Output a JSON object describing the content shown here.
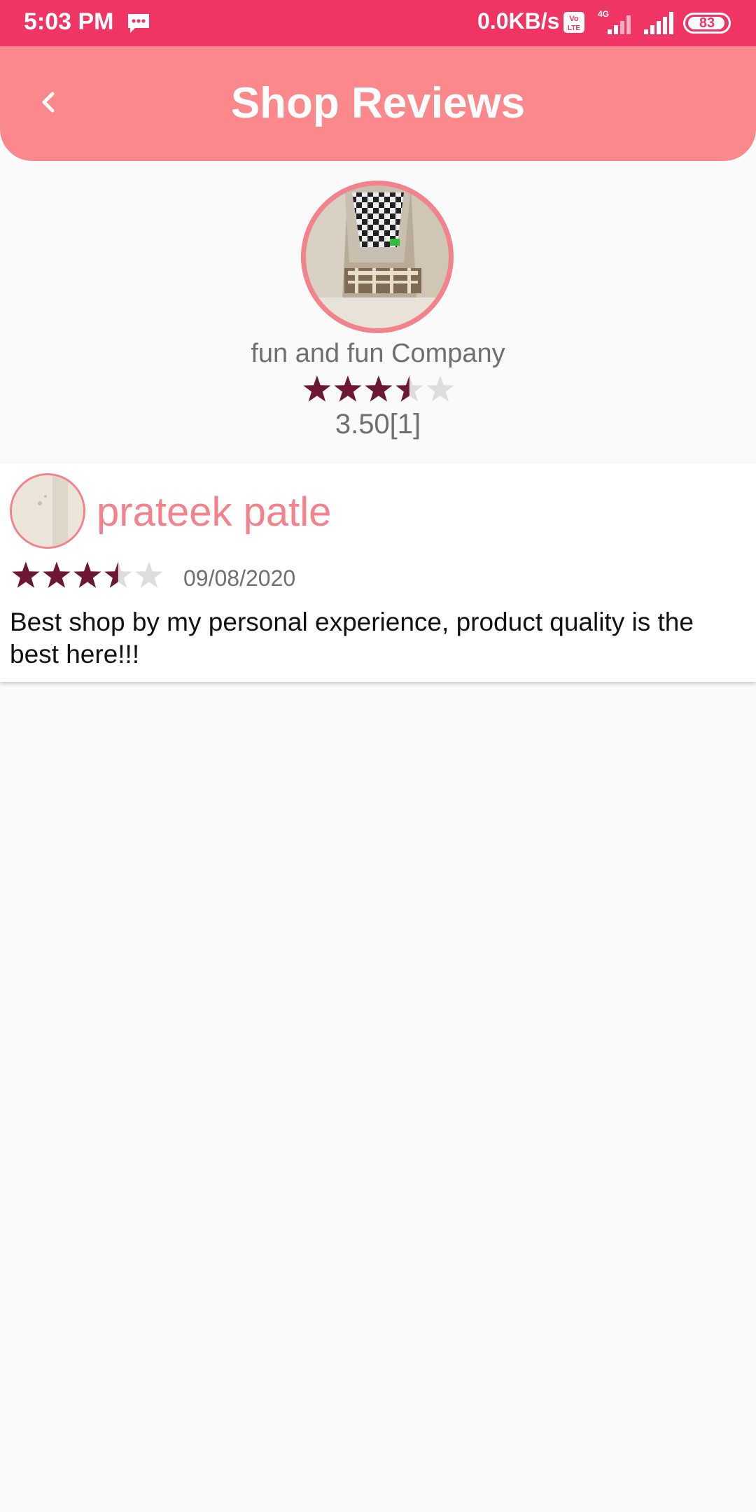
{
  "status_bar": {
    "time": "5:03 PM",
    "net_speed": "0.0KB/s",
    "network_type": "4G",
    "volte_label": "Vo LTE",
    "battery": "83",
    "icons": [
      "message-icon",
      "volte-icon",
      "signal-icon",
      "battery-icon"
    ]
  },
  "header": {
    "title": "Shop Reviews",
    "back_icon": "chevron-left-icon"
  },
  "shop": {
    "name": "fun and fun Company",
    "rating": 3.5,
    "rating_text": "3.50[1]",
    "avatar": "shop-photo"
  },
  "reviews": [
    {
      "reviewer": "prateek patle",
      "rating": 3.5,
      "date": "09/08/2020",
      "text": "Best shop by my personal experience, product quality is the best here!!!"
    }
  ],
  "colors": {
    "status_bar": "#f03564",
    "app_bar": "#fb888b",
    "accent": "#f3828b",
    "star_filled": "#6e1735",
    "star_empty": "#dddddd",
    "background": "#fafafa"
  }
}
